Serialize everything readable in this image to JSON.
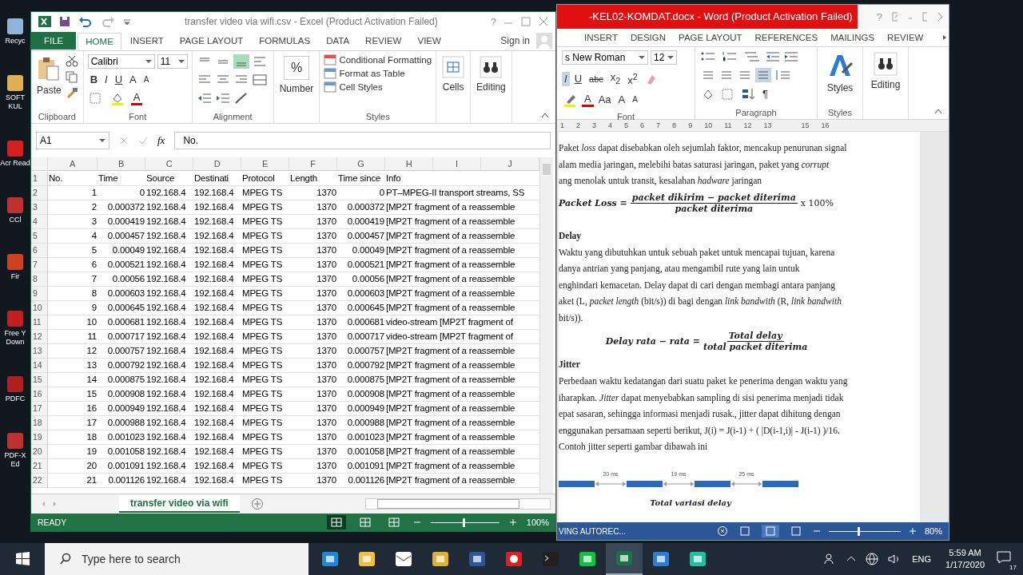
{
  "desktop_icons": [
    {
      "label": "Recyc",
      "color": "#8fb4d8"
    },
    {
      "label": "SOFT KUL",
      "color": "#e0b050"
    },
    {
      "label": "Acr Read",
      "color": "#d42020"
    },
    {
      "label": "CCl",
      "color": "#c03030"
    },
    {
      "label": "Fir",
      "color": "#d04020"
    },
    {
      "label": "Free Y Down",
      "color": "#c02020"
    },
    {
      "label": "PDFC",
      "color": "#b02020"
    },
    {
      "label": "PDF-X Ed",
      "color": "#c03030"
    }
  ],
  "word": {
    "title": "-KEL02-KOMDAT.docx - Word (Product Activation Failed)",
    "help": "?",
    "tabs": [
      {
        "label": "INSERT",
        "selected": false
      },
      {
        "label": "DESIGN",
        "selected": false
      },
      {
        "label": "PAGE LAYOUT",
        "selected": false
      },
      {
        "label": "REFERENCES",
        "selected": false
      },
      {
        "label": "MAILINGS",
        "selected": false
      },
      {
        "label": "REVIEW",
        "selected": false
      }
    ],
    "font": {
      "name": "s New Roman",
      "size": "12",
      "label": "Font",
      "buttons": [
        {
          "label": "I",
          "selected": true
        },
        {
          "label": "U",
          "selected": false
        },
        {
          "label": "abc",
          "selected": false
        },
        {
          "label": "x$_{2}$",
          "selected": false
        },
        {
          "label": "x$^{2}$",
          "selected": false
        }
      ],
      "row3": [
        "A",
        "Aa",
        "A",
        "A"
      ]
    },
    "paragraph": {
      "label": "Paragraph",
      "align": [
        {
          "selected": false
        },
        {
          "selected": false
        },
        {
          "selected": false
        },
        {
          "selected": true
        }
      ],
      "pilcrow": "¶"
    },
    "styles": {
      "button": "Styles",
      "label": "Styles"
    },
    "editing": "Editing",
    "ruler": [
      "1",
      "2",
      "3",
      "4",
      "5",
      "6",
      "7",
      "8",
      "9",
      "10",
      "11",
      "12",
      "13",
      "15",
      "16"
    ],
    "document": [
      {
        "kind": "line",
        "text": "Paket *loss* dapat disebabkan oleh sejumlah faktor, mencakup penurunan signal"
      },
      {
        "kind": "line",
        "text": "alam media jaringan, melebihi batas saturasi jaringan, paket yang *corrupt*"
      },
      {
        "kind": "line",
        "text": "ang menolak untuk transit, kesalahan *hadware* jaringan"
      },
      {
        "kind": "equation",
        "lhs": "Packet Loss =",
        "num": "packet dikirim − packet diterima",
        "den": "packet diterima",
        "rhs": "x 100%"
      },
      {
        "kind": "heading",
        "text": "Delay"
      },
      {
        "kind": "line",
        "text": "Waktu yang dibutuhkan untuk sebuah paket untuk mencapai tujuan, karena"
      },
      {
        "kind": "line",
        "text": "danya antrian yang panjang, atau mengambil rute yang lain untuk"
      },
      {
        "kind": "line",
        "text": "enghindari kemacetan. Delay dapat di cari dengan membagi antara panjang"
      },
      {
        "kind": "line",
        "text": "aket (L, *packet length* (bit/s)) di bagi dengan *link bandwith* (R, *link bandwith*"
      },
      {
        "kind": "line",
        "text": "bit/s))."
      },
      {
        "kind": "equation",
        "lhs": "Delay rata − rata =",
        "num": "Total delay",
        "den": "total packet diterima"
      },
      {
        "kind": "heading",
        "text": "Jitter"
      },
      {
        "kind": "line",
        "text": "Perbedaan waktu kedatangan dari suatu paket ke penerima dengan waktu yang"
      },
      {
        "kind": "line",
        "text": "iharapkan. *Jitter* dapat menyebabkan sampling di sisi penerima menjadi tidak"
      },
      {
        "kind": "line",
        "text": "epat sasaran, sehingga informasi menjadi rusak., jitter dapat dihitung dengan"
      },
      {
        "kind": "line",
        "text": "enggunakan persamaan seperti berikut, J(i) = J(i-1) + ( |D(i-1,i)| - J(i-1) )/16."
      },
      {
        "kind": "line",
        "text": "Contoh jitter seperti gambar dibawah ini"
      },
      {
        "kind": "diagram",
        "gaps": [
          "20 ms",
          "19 ms",
          "25 ms"
        ]
      },
      {
        "kind": "caption",
        "text": "Total variasi delay"
      }
    ],
    "status": "VING AUTOREC...",
    "zoom": {
      "level": 0.4,
      "reading": "80%"
    },
    "views": [
      {
        "selected": false
      },
      {
        "selected": true
      },
      {
        "selected": false
      }
    ]
  },
  "excel": {
    "title": "transfer video via wifi.csv - Excel (Product Activation Failed)",
    "help": "?",
    "tabs": [
      {
        "label": "FILE",
        "kind": "file",
        "selected": false
      },
      {
        "label": "HOME",
        "kind": "tab",
        "selected": true
      },
      {
        "label": "INSERT",
        "kind": "tab",
        "selected": false
      },
      {
        "label": "PAGE LAYOUT",
        "kind": "tab",
        "selected": false
      },
      {
        "label": "FORMULAS",
        "kind": "tab",
        "selected": false
      },
      {
        "label": "DATA",
        "kind": "tab",
        "selected": false
      },
      {
        "label": "REVIEW",
        "kind": "tab",
        "selected": false
      },
      {
        "label": "VIEW",
        "kind": "tab",
        "selected": false
      }
    ],
    "sign_in": "Sign in",
    "clipboard": {
      "paste": "Paste",
      "label": "Clipboard"
    },
    "font": {
      "name": "Calibri",
      "size": "11",
      "buttons": [
        "B",
        "I",
        "U"
      ],
      "sizes": [
        "A",
        "A"
      ],
      "color_button": "A",
      "label": "Font"
    },
    "alignment": {
      "label": "Alignment",
      "vertical": [
        {
          "selected": false
        },
        {
          "selected": false
        },
        {
          "selected": true
        }
      ]
    },
    "number": {
      "symbol": "%",
      "label": "Number"
    },
    "styles": {
      "items": [
        "Conditional Formatting",
        "Format as Table",
        "Cell Styles"
      ],
      "label": "Styles"
    },
    "cells": "Cells",
    "editing": "Editing",
    "name_box": "A1",
    "fx": "fx",
    "formula": "No.",
    "columns": [
      "A",
      "B",
      "C",
      "D",
      "E",
      "F",
      "G",
      "H",
      "I",
      "J"
    ],
    "header_row": {
      "row": "1",
      "cells": [
        "No.",
        "Time",
        "Source",
        "Destinati",
        "Protocol",
        "Length",
        "Time since",
        "Info"
      ]
    },
    "rows": [
      {
        "row": "2",
        "cells": [
          "1",
          "0",
          "192.168.4",
          "192.168.4",
          "MPEG TS",
          "1370",
          "0",
          "PT–MPEG-II transport streams, SS"
        ]
      },
      {
        "row": "3",
        "cells": [
          "2",
          "0.000372",
          "192.168.4",
          "192.168.4",
          "MPEG TS",
          "1370",
          "0.000372",
          "[MP2T fragment of a reassemble"
        ]
      },
      {
        "row": "4",
        "cells": [
          "3",
          "0.000419",
          "192.168.4",
          "192.168.4",
          "MPEG TS",
          "1370",
          "0.000419",
          "[MP2T fragment of a reassemble"
        ]
      },
      {
        "row": "5",
        "cells": [
          "4",
          "0.000457",
          "192.168.4",
          "192.168.4",
          "MPEG TS",
          "1370",
          "0.000457",
          "[MP2T fragment of a reassemble"
        ]
      },
      {
        "row": "6",
        "cells": [
          "5",
          "0.00049",
          "192.168.4",
          "192.168.4",
          "MPEG TS",
          "1370",
          "0.00049",
          "[MP2T fragment of a reassemble"
        ]
      },
      {
        "row": "7",
        "cells": [
          "6",
          "0.000521",
          "192.168.4",
          "192.168.4",
          "MPEG TS",
          "1370",
          "0.000521",
          "[MP2T fragment of a reassemble"
        ]
      },
      {
        "row": "8",
        "cells": [
          "7",
          "0.00056",
          "192.168.4",
          "192.168.4",
          "MPEG TS",
          "1370",
          "0.00056",
          "[MP2T fragment of a reassemble"
        ]
      },
      {
        "row": "9",
        "cells": [
          "8",
          "0.000603",
          "192.168.4",
          "192.168.4",
          "MPEG TS",
          "1370",
          "0.000603",
          "[MP2T fragment of a reassemble"
        ]
      },
      {
        "row": "10",
        "cells": [
          "9",
          "0.000645",
          "192.168.4",
          "192.168.4",
          "MPEG TS",
          "1370",
          "0.000645",
          "[MP2T fragment of a reassemble"
        ]
      },
      {
        "row": "11",
        "cells": [
          "10",
          "0.000681",
          "192.168.4",
          "192.168.4",
          "MPEG TS",
          "1370",
          "0.000681",
          "video-stream  [MP2T fragment of"
        ]
      },
      {
        "row": "12",
        "cells": [
          "11",
          "0.000717",
          "192.168.4",
          "192.168.4",
          "MPEG TS",
          "1370",
          "0.000717",
          "video-stream  [MP2T fragment of"
        ]
      },
      {
        "row": "13",
        "cells": [
          "12",
          "0.000757",
          "192.168.4",
          "192.168.4",
          "MPEG TS",
          "1370",
          "0.000757",
          "[MP2T fragment of a reassemble"
        ]
      },
      {
        "row": "14",
        "cells": [
          "13",
          "0.000792",
          "192.168.4",
          "192.168.4",
          "MPEG TS",
          "1370",
          "0.000792",
          "[MP2T fragment of a reassemble"
        ]
      },
      {
        "row": "15",
        "cells": [
          "14",
          "0.000875",
          "192.168.4",
          "192.168.4",
          "MPEG TS",
          "1370",
          "0.000875",
          "[MP2T fragment of a reassemble"
        ]
      },
      {
        "row": "16",
        "cells": [
          "15",
          "0.000908",
          "192.168.4",
          "192.168.4",
          "MPEG TS",
          "1370",
          "0.000908",
          "[MP2T fragment of a reassemble"
        ]
      },
      {
        "row": "17",
        "cells": [
          "16",
          "0.000949",
          "192.168.4",
          "192.168.4",
          "MPEG TS",
          "1370",
          "0.000949",
          "[MP2T fragment of a reassemble"
        ]
      },
      {
        "row": "18",
        "cells": [
          "17",
          "0.000988",
          "192.168.4",
          "192.168.4",
          "MPEG TS",
          "1370",
          "0.000988",
          "[MP2T fragment of a reassemble"
        ]
      },
      {
        "row": "19",
        "cells": [
          "18",
          "0.001023",
          "192.168.4",
          "192.168.4",
          "MPEG TS",
          "1370",
          "0.001023",
          "[MP2T fragment of a reassemble"
        ]
      },
      {
        "row": "20",
        "cells": [
          "19",
          "0.001058",
          "192.168.4",
          "192.168.4",
          "MPEG TS",
          "1370",
          "0.001058",
          "[MP2T fragment of a reassemble"
        ]
      },
      {
        "row": "21",
        "cells": [
          "20",
          "0.001091",
          "192.168.4",
          "192.168.4",
          "MPEG TS",
          "1370",
          "0.001091",
          "[MP2T fragment of a reassemble"
        ]
      },
      {
        "row": "22",
        "cells": [
          "21",
          "0.001126",
          "192.168.4",
          "192.168.4",
          "MPEG TS",
          "1370",
          "0.001126",
          "[MP2T fragment of a reassemble"
        ]
      }
    ],
    "sheet_tab": "transfer video via wifi",
    "status": "READY",
    "views": [
      {
        "selected": true
      },
      {
        "selected": false
      },
      {
        "selected": false
      }
    ],
    "zoom": {
      "level": 0.47,
      "reading": "100%"
    }
  },
  "taskbar": {
    "search": {
      "placeholder": "Type here to search"
    },
    "apps": [
      {
        "kind": "edge",
        "active": false
      },
      {
        "kind": "folder",
        "active": false
      },
      {
        "kind": "mail",
        "active": false
      },
      {
        "kind": "chrome",
        "active": false
      },
      {
        "kind": "word",
        "active": false
      },
      {
        "kind": "record",
        "active": false
      },
      {
        "kind": "terminal",
        "active": false
      },
      {
        "kind": "chat",
        "active": false
      },
      {
        "kind": "excel",
        "active": true
      },
      {
        "kind": "fin",
        "active": false
      },
      {
        "kind": "filmora",
        "active": false
      }
    ],
    "language": "ENG",
    "time": "5:59 AM",
    "date": "1/17/2020",
    "notifications": "17"
  }
}
